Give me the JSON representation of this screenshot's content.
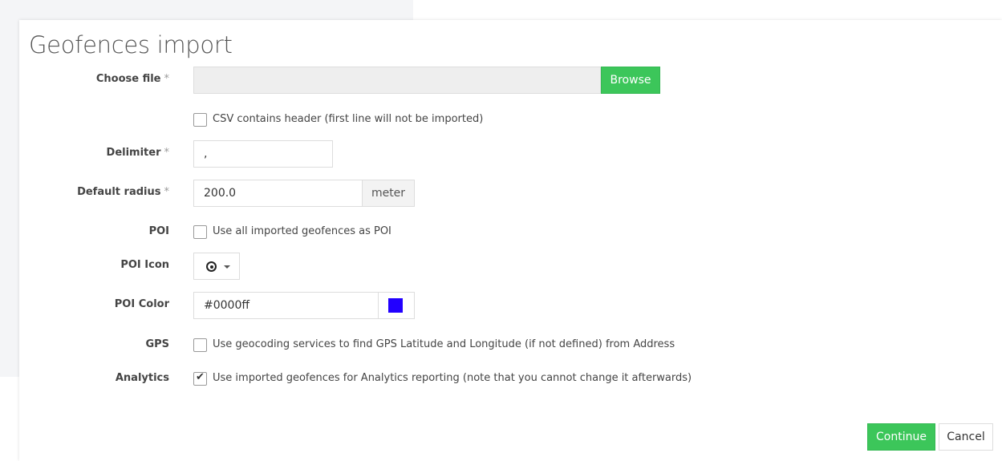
{
  "dialog": {
    "title": "Geofences import"
  },
  "form": {
    "required_mark": "*",
    "choose_file": {
      "label": "Choose file",
      "value": "",
      "browse_label": "Browse"
    },
    "csv_header": {
      "label": "CSV contains header (first line will not be imported)",
      "checked": false
    },
    "delimiter": {
      "label": "Delimiter",
      "value": ","
    },
    "default_radius": {
      "label": "Default radius",
      "value": "200.0",
      "unit": "meter"
    },
    "poi": {
      "label": "POI",
      "checkbox_label": "Use all imported geofences as POI",
      "checked": false
    },
    "poi_icon": {
      "label": "POI Icon",
      "icon": "target-icon"
    },
    "poi_color": {
      "label": "POI Color",
      "value": "#0000ff",
      "swatch": "#2200ff"
    },
    "gps": {
      "label": "GPS",
      "checkbox_label": "Use geocoding services to find GPS Latitude and Longitude (if not defined) from Address",
      "checked": false
    },
    "analytics": {
      "label": "Analytics",
      "checkbox_label": "Use imported geofences for Analytics reporting (note that you cannot change it afterwards)",
      "checked": true
    }
  },
  "footer": {
    "continue_label": "Continue",
    "cancel_label": "Cancel"
  },
  "colors": {
    "accent_green": "#3cc65a",
    "background_panel": "#f4f5f7"
  }
}
